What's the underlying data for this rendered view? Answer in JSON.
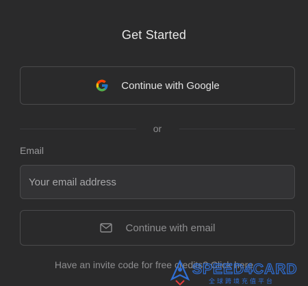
{
  "auth": {
    "title": "Get Started",
    "google_button_label": "Continue with Google",
    "divider_text": "or",
    "email_label": "Email",
    "email_placeholder": "Your email address",
    "email_value": "",
    "email_button_label": "Continue with email",
    "invite_text": "Have an invite code for free credits?",
    "invite_link": "Click here"
  },
  "watermark": {
    "brand": "SPEED4CARD",
    "tagline": "全球跨境充值平台"
  },
  "icons": {
    "google": "google-g-icon",
    "email": "mail-icon"
  },
  "colors": {
    "background": "#2a2a2b",
    "border": "#4a4a4c",
    "input_bg": "#333335",
    "text_primary": "#e8e8e8",
    "text_muted": "#8e8e90",
    "watermark_blue": "#2f6fd6"
  }
}
